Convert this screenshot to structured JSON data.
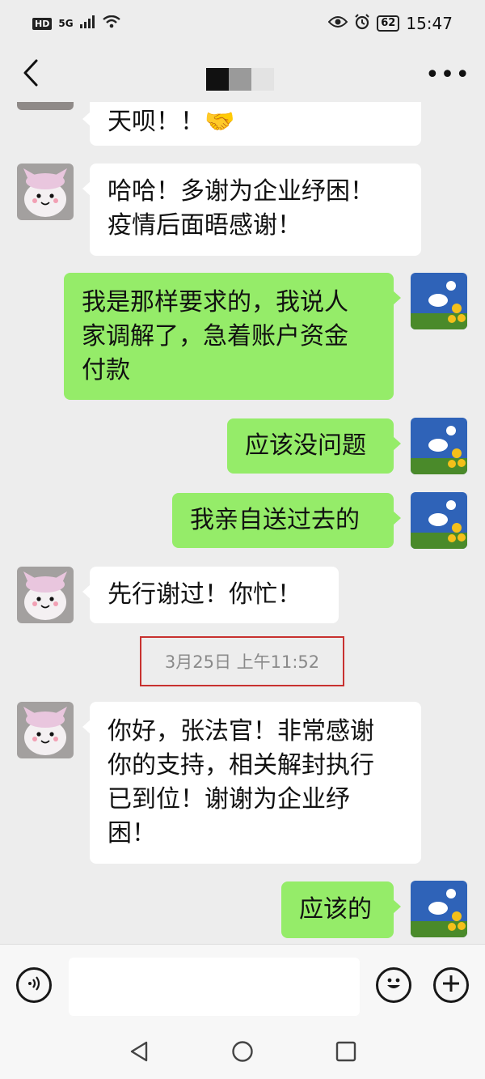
{
  "status_bar": {
    "hd": "HD",
    "network": "5G",
    "battery": "62",
    "time": "15:47"
  },
  "nav": {
    "back_icon": "chevron-left-icon",
    "more_label": "•••"
  },
  "chat": {
    "messages": [
      {
        "side": "in",
        "text": "天呗！！🤝"
      },
      {
        "side": "in",
        "text": "哈哈！多谢为企业纾困！\n疫情后面晤感谢！"
      },
      {
        "side": "out",
        "text": "我是那样要求的，我说人\n家调解了，急着账户资金\n付款"
      },
      {
        "side": "out",
        "text": "应该没问题"
      },
      {
        "side": "out",
        "text": "我亲自送过去的"
      },
      {
        "side": "in",
        "text": "先行谢过！你忙！"
      },
      {
        "side": "in",
        "text": "你好，张法官！非常感谢\n你的支持，相关解封执行\n已到位！谢谢为企业纾\n困！"
      },
      {
        "side": "out",
        "text": "应该的"
      }
    ],
    "timestamp": "3月25日 上午11:52"
  },
  "input_bar": {
    "voice_icon": "voice-icon",
    "emoji_icon": "emoji-icon",
    "plus_icon": "plus-icon",
    "placeholder": ""
  },
  "colors": {
    "background": "#ededed",
    "incoming_bubble": "#ffffff",
    "outgoing_bubble": "#95ec69",
    "timestamp_border": "#c8312f"
  }
}
